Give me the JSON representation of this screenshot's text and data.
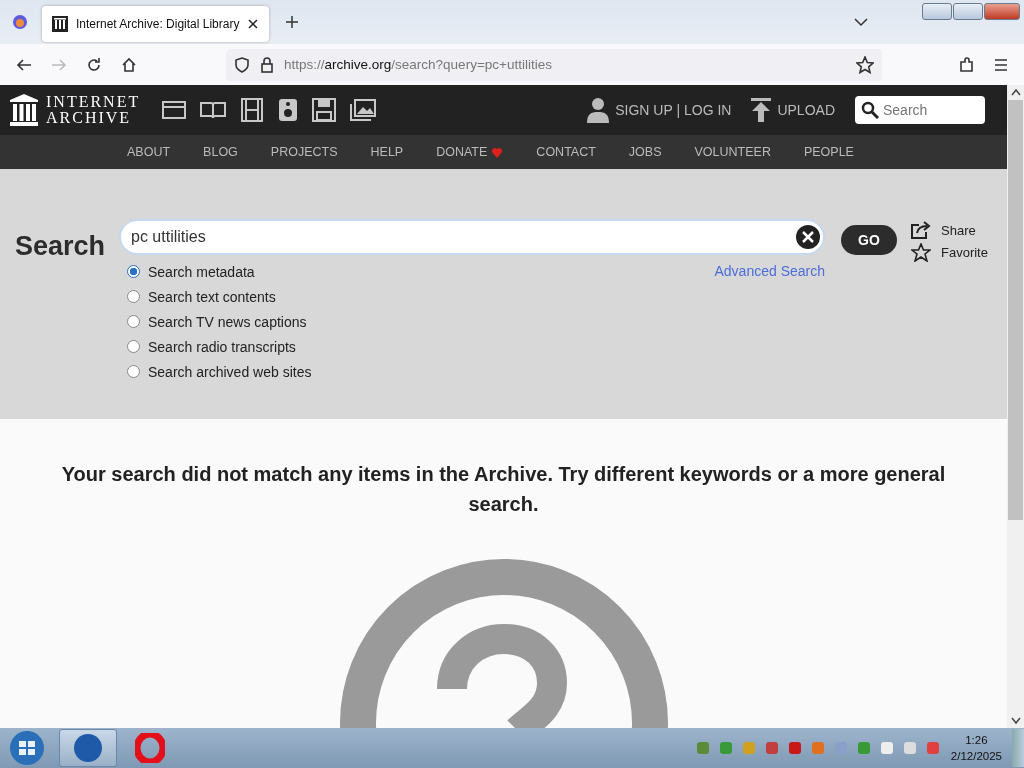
{
  "browser": {
    "tab": {
      "title": "Internet Archive: Digital Library",
      "selected": true
    },
    "url": {
      "scheme": "https://",
      "host": "archive.org",
      "path": "/search?query=pc+uttilities"
    }
  },
  "header": {
    "logo": [
      "INTERNET",
      "ARCHIVE"
    ],
    "account": "SIGN UP | LOG IN",
    "upload": "UPLOAD",
    "search": {
      "placeholder": "Search"
    }
  },
  "nav": [
    {
      "label": "ABOUT",
      "kind": "link"
    },
    {
      "label": "BLOG",
      "kind": "link"
    },
    {
      "label": "PROJECTS",
      "kind": "link"
    },
    {
      "label": "HELP",
      "kind": "link"
    },
    {
      "label": "DONATE",
      "kind": "donate"
    },
    {
      "label": "CONTACT",
      "kind": "link"
    },
    {
      "label": "JOBS",
      "kind": "link"
    },
    {
      "label": "VOLUNTEER",
      "kind": "link"
    },
    {
      "label": "PEOPLE",
      "kind": "link"
    }
  ],
  "search": {
    "heading": "Search",
    "value": "pc uttilities",
    "go": "GO",
    "advanced": "Advanced Search",
    "share": "Share",
    "favorite": "Favorite",
    "options": [
      {
        "label": "Search metadata",
        "selected": true
      },
      {
        "label": "Search text contents",
        "selected": false
      },
      {
        "label": "Search TV news captions",
        "selected": false
      },
      {
        "label": "Search radio transcripts",
        "selected": false
      },
      {
        "label": "Search archived web sites",
        "selected": false
      }
    ]
  },
  "message": "Your search did not match any items in the Archive. Try different keywords or a more general search.",
  "taskbar": {
    "time": "1:26",
    "date": "2/12/2025"
  }
}
